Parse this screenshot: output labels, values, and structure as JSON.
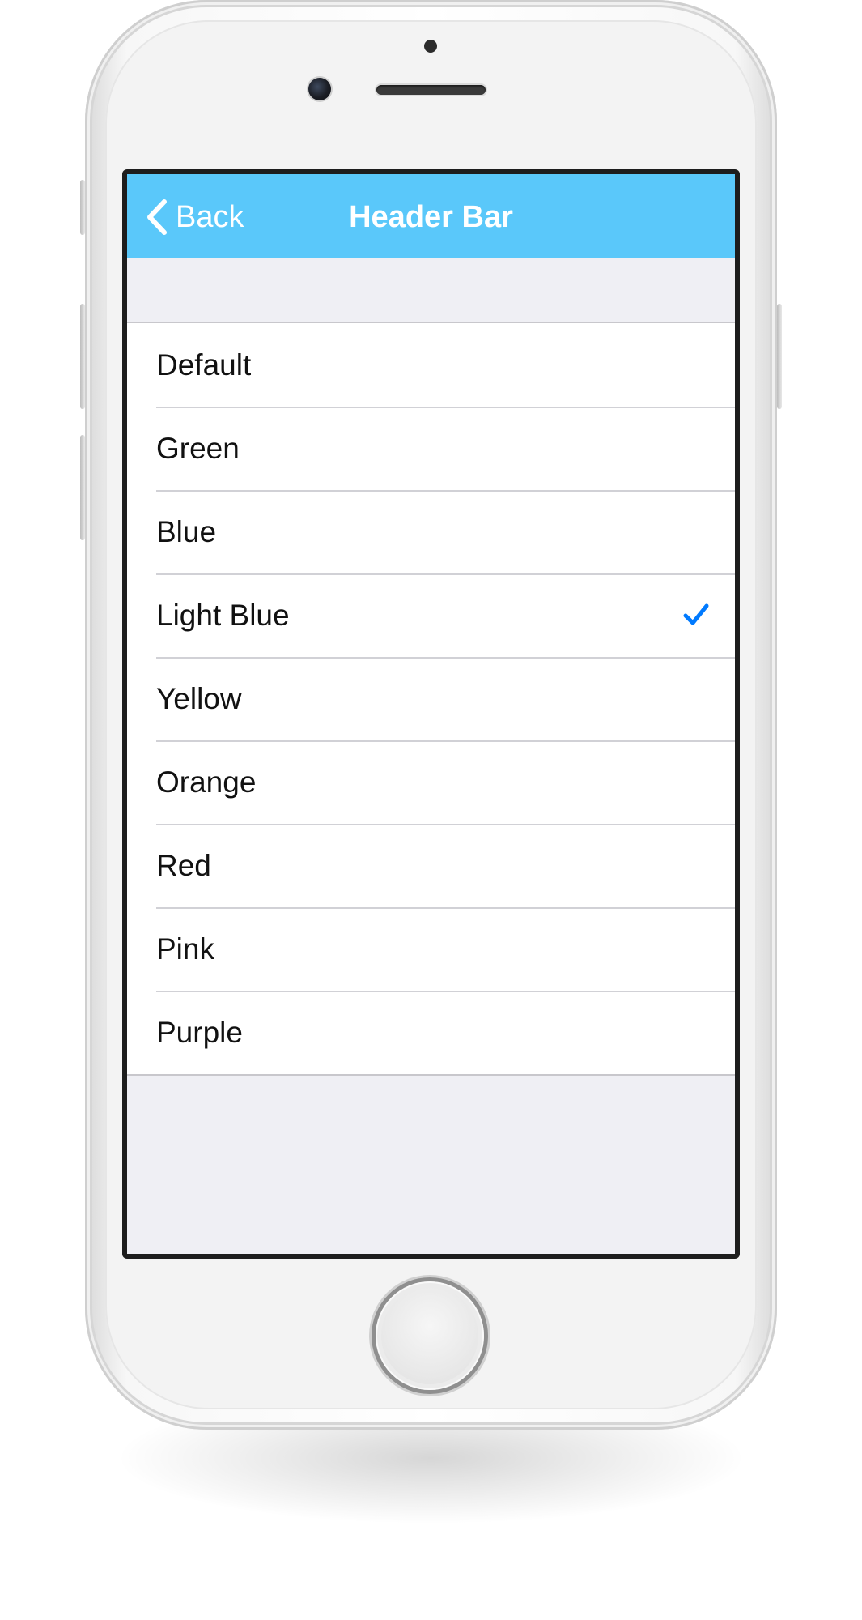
{
  "nav": {
    "back_label": "Back",
    "title": "Header Bar",
    "back_icon": "chevron-left-icon"
  },
  "list": {
    "items": [
      {
        "label": "Default",
        "selected": false
      },
      {
        "label": "Green",
        "selected": false
      },
      {
        "label": "Blue",
        "selected": false
      },
      {
        "label": "Light Blue",
        "selected": true
      },
      {
        "label": "Yellow",
        "selected": false
      },
      {
        "label": "Orange",
        "selected": false
      },
      {
        "label": "Red",
        "selected": false
      },
      {
        "label": "Pink",
        "selected": false
      },
      {
        "label": "Purple",
        "selected": false
      }
    ],
    "selected_icon": "checkmark-icon"
  },
  "colors": {
    "navbar": "#5ac8fa",
    "nav_text": "#ffffff",
    "checkmark": "#007aff",
    "background": "#efeff4"
  }
}
